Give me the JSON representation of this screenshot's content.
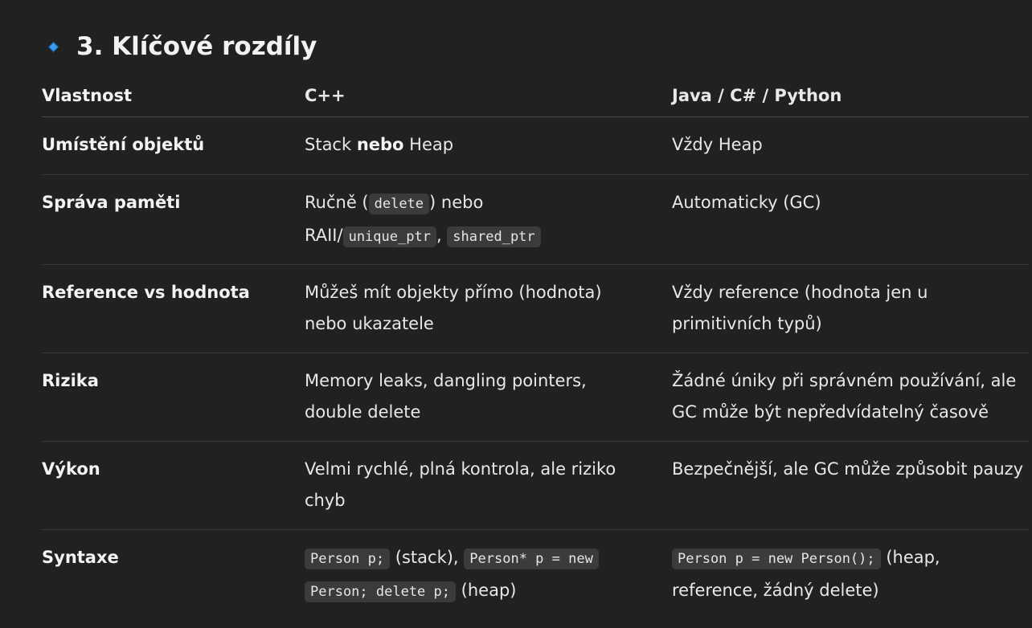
{
  "heading": {
    "icon": "small-blue-diamond-icon",
    "title": "3. Klíčové rozdíly",
    "accent_color": "#3b9bf0"
  },
  "table": {
    "headers": [
      "Vlastnost",
      "C++",
      "Java / C# / Python"
    ],
    "rows": [
      {
        "property": "Umístění objektů",
        "cpp": {
          "a": "Stack ",
          "b_bold": "nebo",
          "c": " Heap"
        },
        "java": "Vždy Heap"
      },
      {
        "property": "Správa paměti",
        "cpp": {
          "a": "Ručně (",
          "code1": "delete",
          "b": ") nebo",
          "c": "RAII/",
          "code2": "unique_ptr",
          "d": ", ",
          "code3": "shared_ptr"
        },
        "java": "Automaticky (GC)"
      },
      {
        "property": "Reference vs hodnota",
        "cpp": {
          "line1": "Můžeš mít objekty přímo (hodnota)",
          "line2": "nebo ukazatele"
        },
        "java": {
          "line1": "Vždy reference (hodnota jen u",
          "line2": "primitivních typů)"
        }
      },
      {
        "property": "Rizika",
        "cpp": {
          "line1": "Memory leaks, dangling pointers,",
          "line2": "double delete"
        },
        "java": {
          "line1": "Žádné úniky při správném používání, ale",
          "line2": "GC může být nepředvídatelný časově"
        }
      },
      {
        "property": "Výkon",
        "cpp": {
          "line1": "Velmi rychlé, plná kontrola, ale riziko",
          "line2": "chyb"
        },
        "java": "Bezpečnější, ale GC může způsobit pauzy"
      },
      {
        "property": "Syntaxe",
        "cpp": {
          "code1": "Person p;",
          "a": " (stack), ",
          "code2": "Person* p = new",
          "code3": "Person; delete p;",
          "b": " (heap)"
        },
        "java": {
          "code1": "Person p = new Person();",
          "a": " (heap,",
          "line2": "reference, žádný delete)"
        }
      }
    ]
  }
}
